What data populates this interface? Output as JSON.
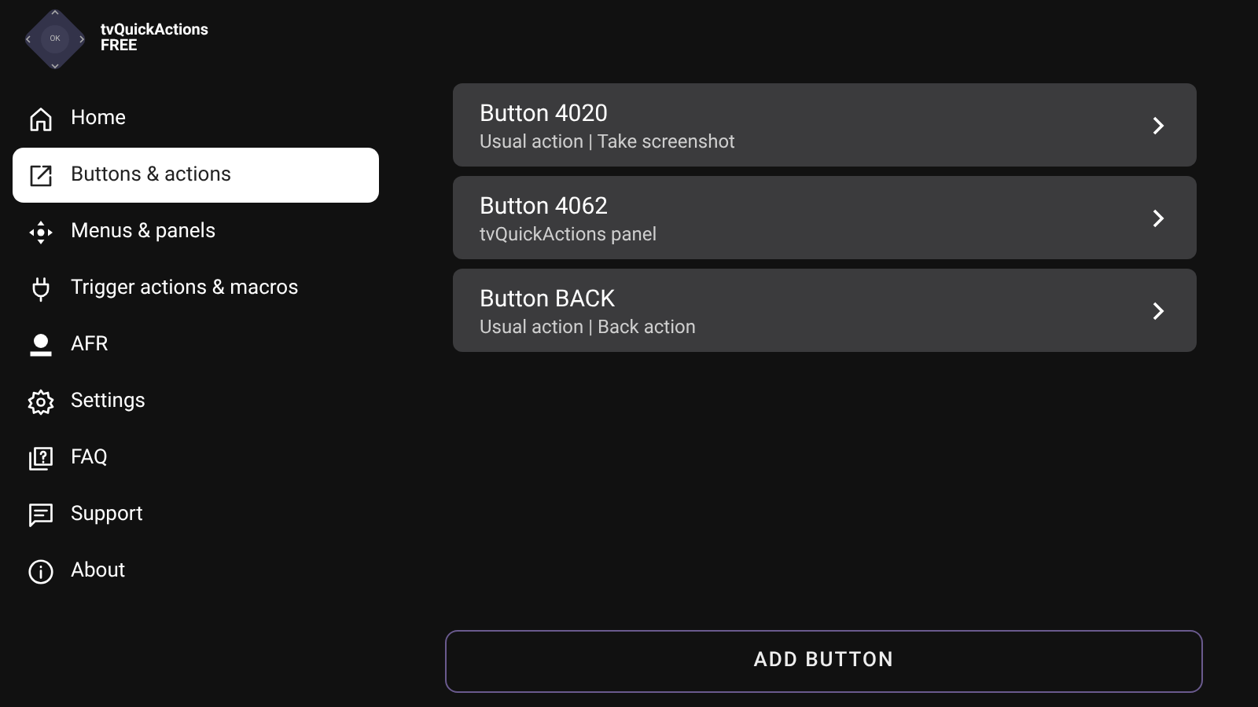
{
  "app": {
    "logo_label": "OK",
    "title": "tvQuickActions",
    "edition": "FREE"
  },
  "sidebar": {
    "items": [
      {
        "label": "Home",
        "selected": false
      },
      {
        "label": "Buttons & actions",
        "selected": true
      },
      {
        "label": "Menus & panels",
        "selected": false
      },
      {
        "label": "Trigger actions & macros",
        "selected": false
      },
      {
        "label": "AFR",
        "selected": false
      },
      {
        "label": "Settings",
        "selected": false
      },
      {
        "label": "FAQ",
        "selected": false
      },
      {
        "label": "Support",
        "selected": false
      },
      {
        "label": "About",
        "selected": false
      }
    ]
  },
  "buttons": [
    {
      "title": "Button 4020",
      "subtitle": "Usual action | Take screenshot"
    },
    {
      "title": "Button 4062",
      "subtitle": "tvQuickActions panel"
    },
    {
      "title": "Button BACK",
      "subtitle": "Usual action | Back action"
    }
  ],
  "add_button": {
    "label": "ADD BUTTON"
  }
}
